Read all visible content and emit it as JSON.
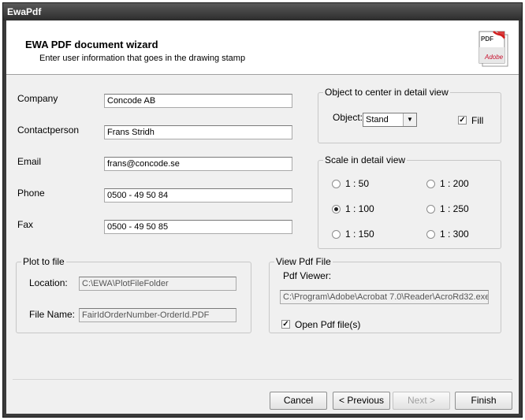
{
  "window": {
    "title": "EwaPdf"
  },
  "header": {
    "title": "EWA PDF document wizard",
    "subtitle": "Enter user information that goes in the drawing stamp",
    "logo_top_text": "PDF",
    "logo_brand": "Adobe"
  },
  "user": {
    "company_label": "Company",
    "company_value": "Concode AB",
    "contact_label": "Contactperson",
    "contact_value": "Frans Stridh",
    "email_label": "Email",
    "email_value": "frans@concode.se",
    "phone_label": "Phone",
    "phone_value": "0500 - 49 50 84",
    "fax_label": "Fax",
    "fax_value": "0500 - 49 50 85"
  },
  "center_object": {
    "legend": "Object to center in detail view",
    "object_label": "Object:",
    "object_value": "Stand",
    "fill_label": "Fill",
    "fill_checked": true
  },
  "scale": {
    "legend": "Scale in detail view",
    "options": [
      "1 : 50",
      "1 : 200",
      "1 : 100",
      "1 : 250",
      "1 : 150",
      "1 : 300"
    ],
    "selected": "1 : 100"
  },
  "plot": {
    "legend": "Plot to file",
    "location_label": "Location:",
    "location_value": "C:\\EWA\\PlotFileFolder",
    "filename_label": "File Name:",
    "filename_value": "FairIdOrderNumber-OrderId.PDF"
  },
  "view_pdf": {
    "legend": "View Pdf File",
    "viewer_label": "Pdf Viewer:",
    "viewer_value": "C:\\Program\\Adobe\\Acrobat 7.0\\Reader\\AcroRd32.exe",
    "open_label": "Open Pdf file(s)",
    "open_checked": true
  },
  "buttons": {
    "cancel": "Cancel",
    "previous": "< Previous",
    "next": "Next >",
    "finish": "Finish"
  }
}
